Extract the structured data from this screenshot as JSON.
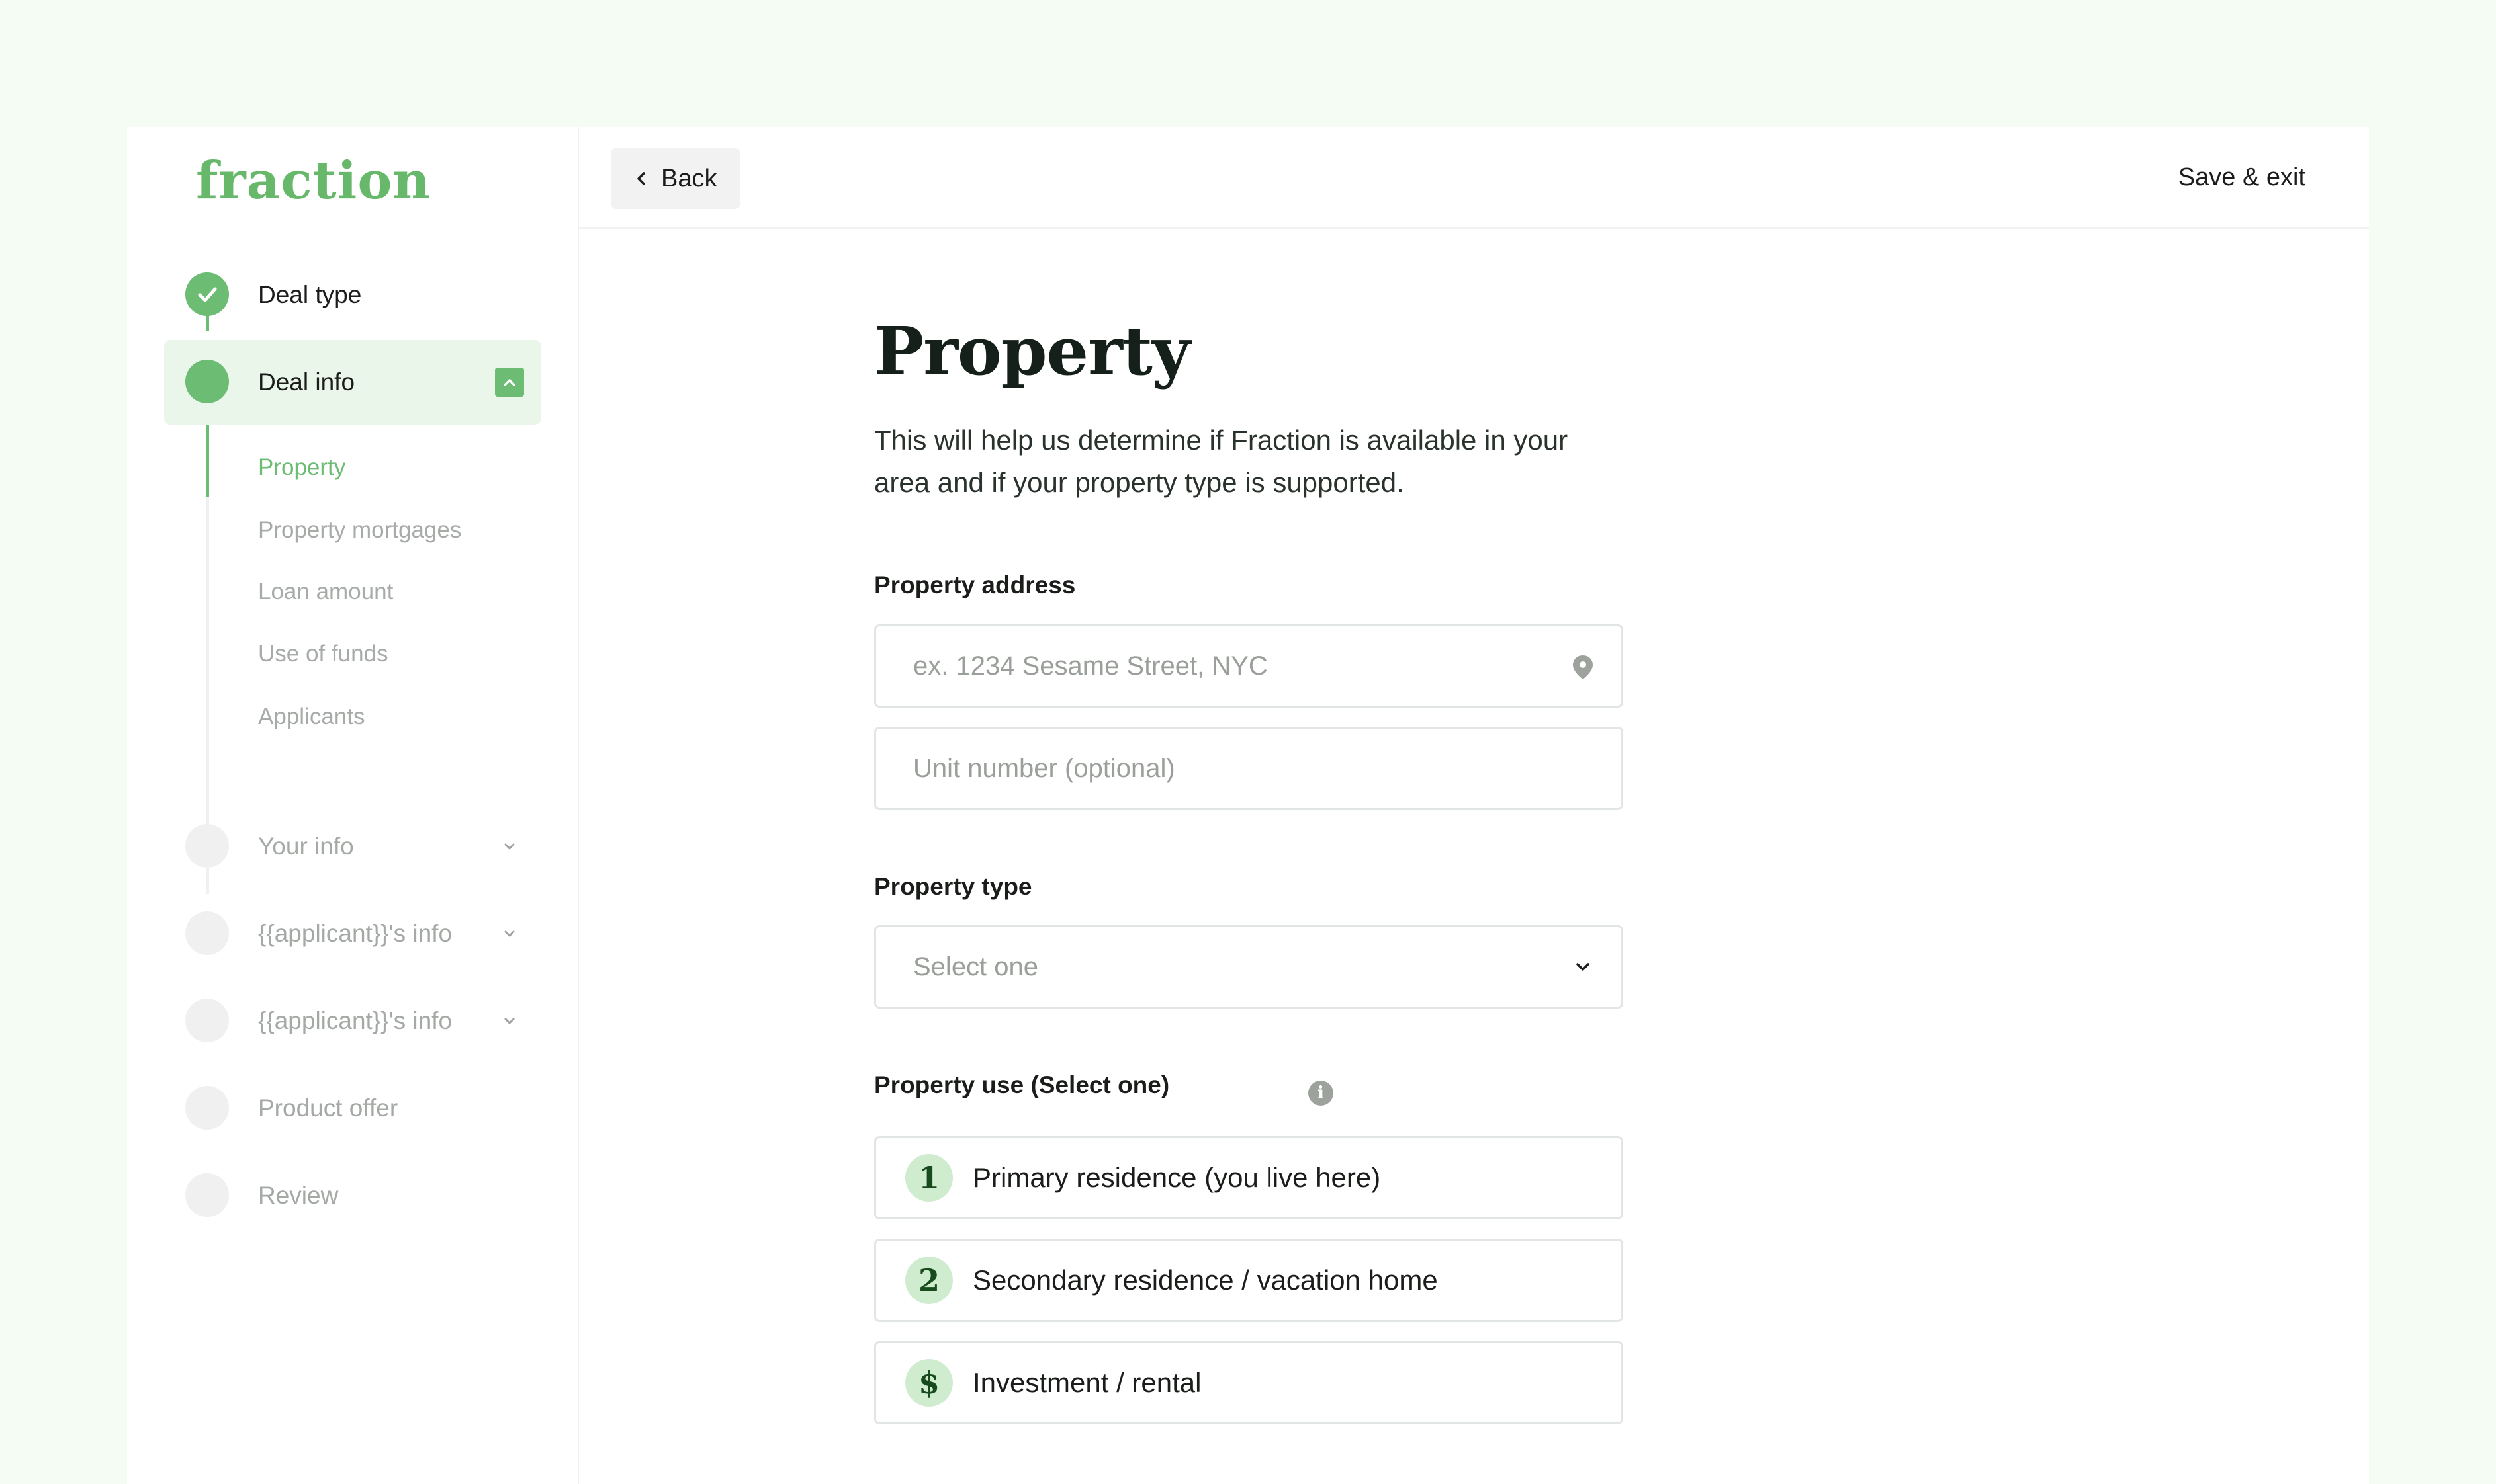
{
  "brand": {
    "logo_text": "fraction",
    "accent": "#6cbc73"
  },
  "header": {
    "back_label": "Back",
    "save_exit_label": "Save & exit"
  },
  "sidebar": {
    "steps": [
      {
        "label": "Deal type",
        "state": "done"
      },
      {
        "label": "Deal info",
        "state": "active",
        "expanded": true
      },
      {
        "label": "Your info",
        "state": "pending"
      },
      {
        "label": "{{applicant}}'s info",
        "state": "pending"
      },
      {
        "label": "{{applicant}}'s info",
        "state": "pending"
      },
      {
        "label": "Product offer",
        "state": "pending"
      },
      {
        "label": "Review",
        "state": "pending"
      }
    ],
    "substeps": [
      {
        "label": "Property",
        "current": true
      },
      {
        "label": "Property mortgages"
      },
      {
        "label": "Loan amount"
      },
      {
        "label": "Use of funds"
      },
      {
        "label": "Applicants"
      }
    ]
  },
  "main": {
    "title": "Property",
    "subtitle": "This will help us determine if Fraction is available in your area and if your property type is supported.",
    "address": {
      "label": "Property address",
      "placeholder": "ex. 1234 Sesame Street, NYC",
      "unit_placeholder": "Unit number (optional)"
    },
    "property_type": {
      "label": "Property type",
      "selected": "Select one"
    },
    "property_use": {
      "label": "Property use (Select one)",
      "options": [
        {
          "badge": "1",
          "label": "Primary residence (you live here)"
        },
        {
          "badge": "2",
          "label": "Secondary residence / vacation home"
        },
        {
          "badge": "$",
          "label": "Investment / rental"
        }
      ]
    }
  }
}
